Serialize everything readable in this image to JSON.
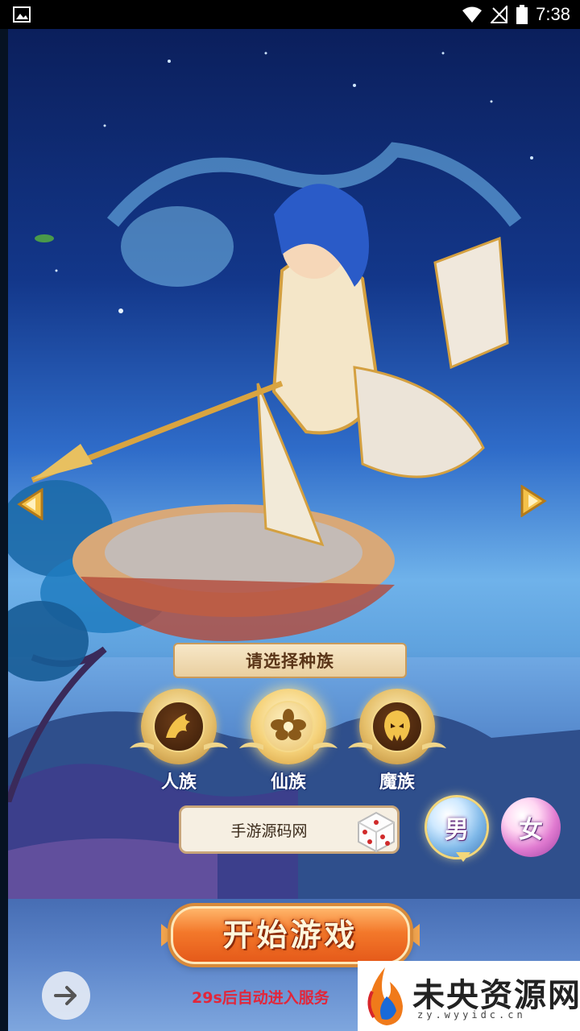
{
  "status_bar": {
    "time": "7:38",
    "icons": [
      "image-icon",
      "wifi-icon",
      "signal-off-icon",
      "battery-icon"
    ]
  },
  "race_select": {
    "title": "请选择种族",
    "options": [
      {
        "label": "人族",
        "icon": "dragon-emblem-icon",
        "selected": false
      },
      {
        "label": "仙族",
        "icon": "lotus-emblem-icon",
        "selected": true
      },
      {
        "label": "魔族",
        "icon": "demon-emblem-icon",
        "selected": false
      }
    ]
  },
  "character_name": {
    "value": "手游源码网",
    "random_button": "dice-icon"
  },
  "gender": {
    "male_label": "男",
    "female_label": "女",
    "selected": "male"
  },
  "start_button": {
    "label": "开始游戏"
  },
  "countdown_text": "29s后自动进入服务",
  "watermark": {
    "title": "未央资源网",
    "subtitle": "zy.wyyidc.cn"
  },
  "colors": {
    "accent_gold": "#e6c06b",
    "start_orange": "#f3782a",
    "countdown_red": "#e2263a"
  }
}
